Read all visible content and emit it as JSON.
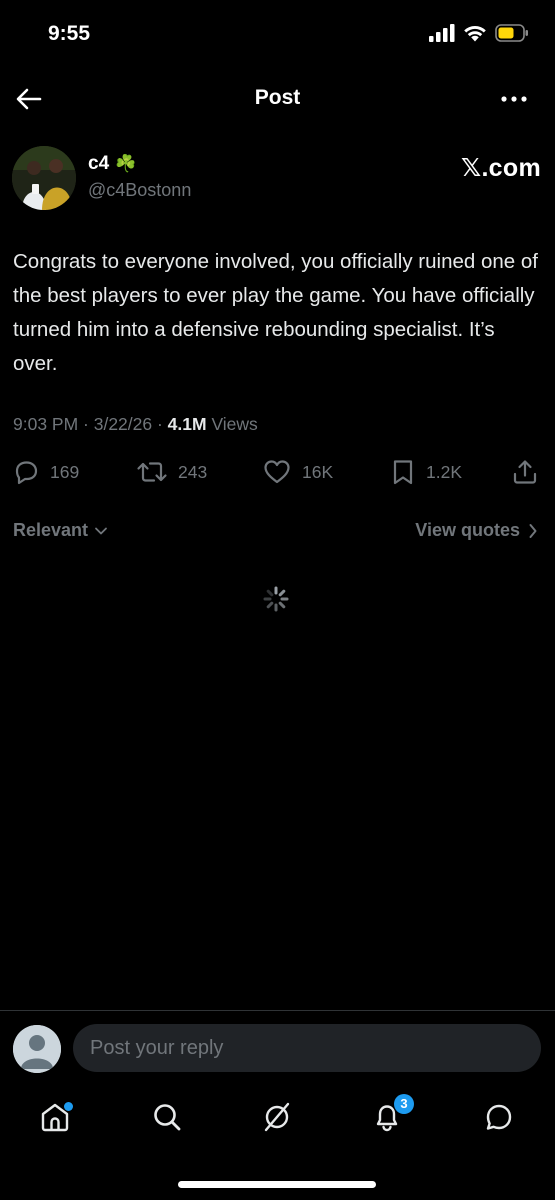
{
  "status_bar": {
    "time": "9:55",
    "icons": [
      "signal-icon",
      "wifi-icon",
      "battery-icon"
    ]
  },
  "header": {
    "title": "Post",
    "back_icon": "back-arrow-icon",
    "more_icon": "more-icon"
  },
  "post": {
    "author": {
      "name": "c4",
      "emoji": "☘️",
      "handle": "@c4Bostonn"
    },
    "source": "𝕏.com",
    "text": "Congrats to everyone involved, you officially ruined one of the best players to ever play the game. You have officially turned him into a defensive rebounding specialist. It’s over.",
    "timestamp": "9:03 PM · 3/22/26 · ",
    "views_count": "4.1M",
    "views_label": " Views",
    "actions": {
      "replies": "169",
      "reposts": "243",
      "likes": "16K",
      "bookmarks": "1.2K"
    }
  },
  "replies_bar": {
    "sort_label": "Relevant",
    "view_quotes_label": "View quotes"
  },
  "reply_box": {
    "placeholder": "Post your reply"
  },
  "tab_bar": {
    "notifications_badge": "3",
    "accent": "#1d9bf0"
  },
  "colors": {
    "background": "#000000",
    "text_primary": "#e7e9ea",
    "text_secondary": "#71767b",
    "accent": "#1d9bf0"
  }
}
